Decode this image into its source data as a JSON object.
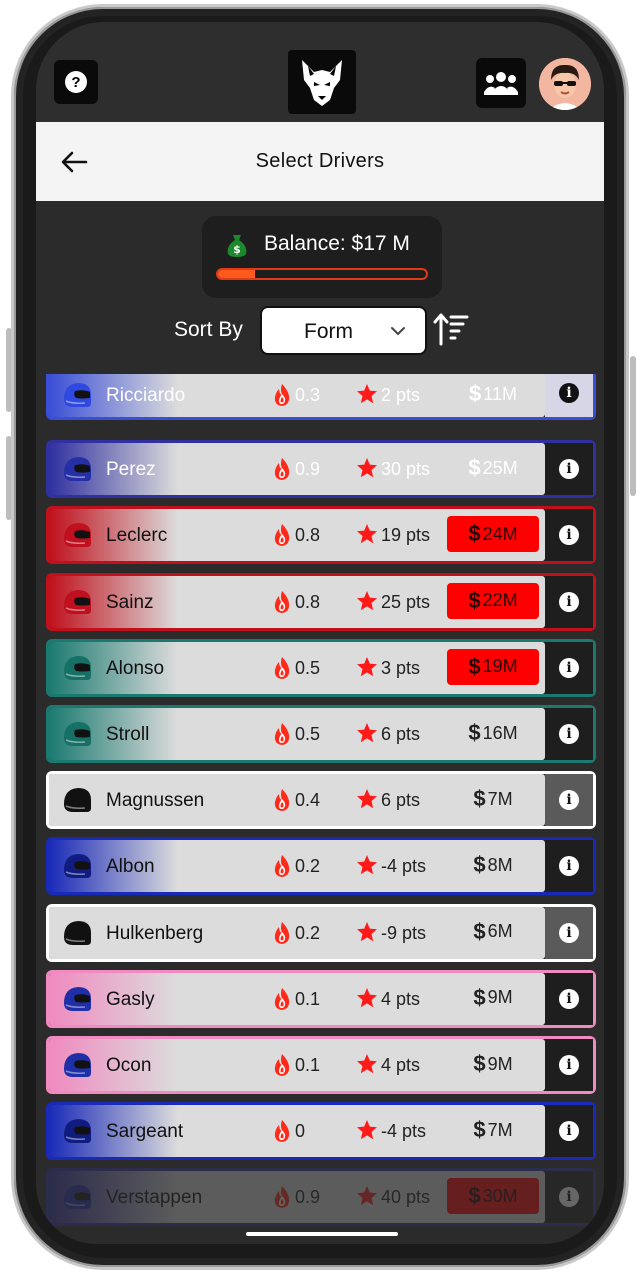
{
  "header": {
    "title": "Select Drivers"
  },
  "balance": {
    "label": "Balance: $17 M",
    "progress": 0.18
  },
  "sort": {
    "label": "Sort By",
    "value": "Form"
  },
  "drivers": [
    {
      "name": "Ricciardo",
      "form": "0.3",
      "points": "2 pts",
      "price": "11M",
      "team_color": "#3a4fd6",
      "helmet_color": "#2f49e0",
      "affordable": true
    },
    {
      "name": "Perez",
      "form": "0.9",
      "points": "30 pts",
      "price": "25M",
      "team_color": "#3030a0",
      "helmet_color": "#2530a8",
      "affordable": false
    },
    {
      "name": "Leclerc",
      "form": "0.8",
      "points": "19 pts",
      "price": "24M",
      "team_color": "#c0101c",
      "helmet_color": "#c01020",
      "affordable": false
    },
    {
      "name": "Sainz",
      "form": "0.8",
      "points": "25 pts",
      "price": "22M",
      "team_color": "#c0101c",
      "helmet_color": "#c01020",
      "affordable": false
    },
    {
      "name": "Alonso",
      "form": "0.5",
      "points": "3 pts",
      "price": "19M",
      "team_color": "#1b7a70",
      "helmet_color": "#167066",
      "affordable": false
    },
    {
      "name": "Stroll",
      "form": "0.5",
      "points": "6 pts",
      "price": "16M",
      "team_color": "#1b7a70",
      "helmet_color": "#167066",
      "affordable": true
    },
    {
      "name": "Magnussen",
      "form": "0.4",
      "points": "6 pts",
      "price": "7M",
      "team_color": "#ffffff",
      "helmet_color": "#111111",
      "affordable": true
    },
    {
      "name": "Albon",
      "form": "0.2",
      "points": "-4 pts",
      "price": "8M",
      "team_color": "#1a2ab8",
      "helmet_color": "#101c80",
      "affordable": true
    },
    {
      "name": "Hulkenberg",
      "form": "0.2",
      "points": "-9 pts",
      "price": "6M",
      "team_color": "#ffffff",
      "helmet_color": "#111111",
      "affordable": true
    },
    {
      "name": "Gasly",
      "form": "0.1",
      "points": "4 pts",
      "price": "9M",
      "team_color": "#f08ac0",
      "helmet_color": "#1f2fa8",
      "affordable": true
    },
    {
      "name": "Ocon",
      "form": "0.1",
      "points": "4 pts",
      "price": "9M",
      "team_color": "#f08ac0",
      "helmet_color": "#1f2fa8",
      "affordable": true
    },
    {
      "name": "Sargeant",
      "form": "0",
      "points": "-4 pts",
      "price": "7M",
      "team_color": "#1a2ab8",
      "helmet_color": "#101c80",
      "affordable": true
    },
    {
      "name": "Verstappen",
      "form": "0.9",
      "points": "40 pts",
      "price": "30M",
      "team_color": "#3030a0",
      "helmet_color": "#2530a8",
      "affordable": false
    }
  ],
  "colors": {
    "accent": "#ff5b1d",
    "danger": "#ff0000",
    "background": "#2b2b2b",
    "header": "#f4f4f4"
  },
  "icons": {
    "help": "help-icon",
    "logo": "wolf-logo",
    "team": "team-icon",
    "avatar": "avatar",
    "back": "back-arrow-icon",
    "money": "money-bag-icon",
    "sort_direction": "sort-ascending-icon",
    "form": "flame-icon",
    "points": "star-icon",
    "info": "info-icon",
    "helmet": "helmet-icon"
  }
}
